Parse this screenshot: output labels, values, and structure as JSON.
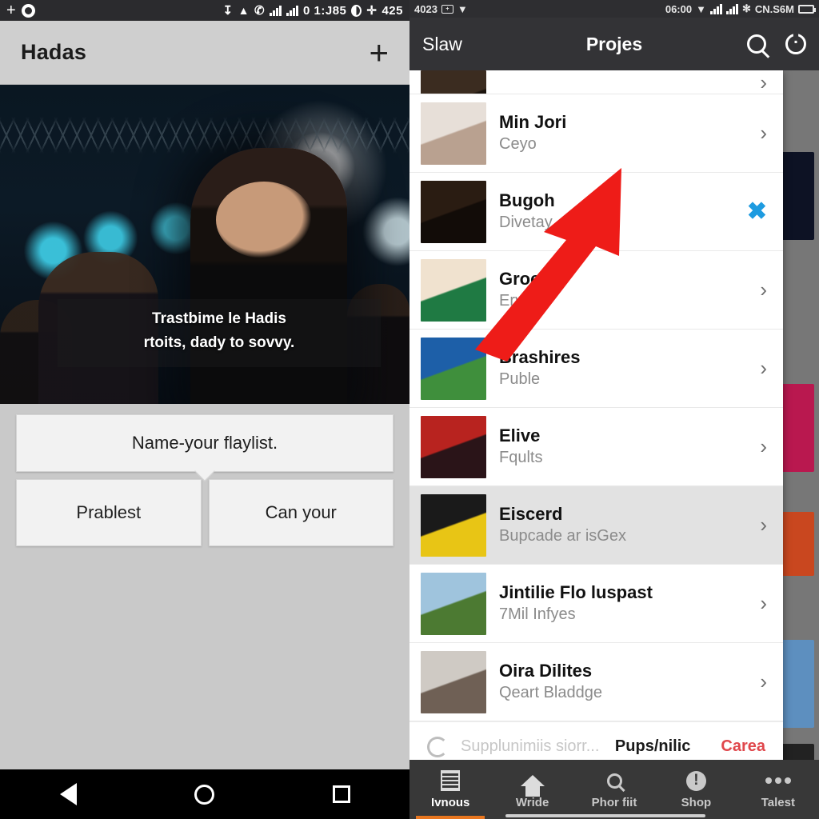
{
  "left": {
    "status_bar": {
      "add_icon": "plus-icon",
      "app_icon": "ghost-app-icon",
      "download_icon": "download-arrow-icon",
      "wifi_icon": "wifi-icon",
      "vibrate_icon": "vibrate-icon",
      "signal_icon_1": "signal-bars-icon",
      "signal_icon_2": "signal-bars-icon",
      "clock": "0 1:J85",
      "brightness_icon": "brightness-icon",
      "move_icon": "move-icon",
      "battery": "425"
    },
    "app_bar": {
      "title": "Hadas",
      "add_label": "+"
    },
    "hero": {
      "caption_line1": "Trastbime le Hadis",
      "caption_line2": "rtoits, dady to sovvy."
    },
    "dialog": {
      "message": "Name-your flaylist.",
      "button_left": "Prablest",
      "button_right": "Can your"
    },
    "nav": {
      "back": "back-icon",
      "home": "home-icon",
      "recents": "recents-icon"
    }
  },
  "right": {
    "status_bar": {
      "carrier": "4023",
      "sim_icon": "sim-card-icon",
      "wifi_icon": "wifi-icon",
      "clock": "06:00",
      "wifi2_icon": "wifi-icon",
      "signal_icon_1": "signal-bars-icon",
      "signal_icon_2": "signal-bars-icon",
      "bluetooth_icon": "bluetooth-icon",
      "network": "CN.S6M",
      "battery_icon": "battery-icon"
    },
    "app_bar": {
      "back_label": "Slaw",
      "title": "Projes",
      "search_icon": "search-icon",
      "power_icon": "power-icon"
    },
    "list": [
      {
        "title": "",
        "subtitle": "",
        "action": "chevron-right-icon",
        "cut": true,
        "selected": false,
        "thumb": {
          "a": "#3b2c20",
          "b": "#1b130d"
        }
      },
      {
        "title": "Min Jori",
        "subtitle": "Ceyo",
        "action": "chevron-right-icon",
        "cut": false,
        "selected": false,
        "thumb": {
          "a": "#e7dfd8",
          "b": "#b9a190"
        }
      },
      {
        "title": "Bugoh",
        "subtitle": "Divetay",
        "action": "close-icon",
        "cut": false,
        "selected": false,
        "thumb": {
          "a": "#2a1c12",
          "b": "#120c08"
        }
      },
      {
        "title": "Groens",
        "subtitle": "Ervoso",
        "action": "chevron-right-icon",
        "cut": false,
        "selected": false,
        "thumb": {
          "a": "#f0e2cf",
          "b": "#1f7a43"
        }
      },
      {
        "title": "Brashires",
        "subtitle": "Puble",
        "action": "chevron-right-icon",
        "cut": false,
        "selected": false,
        "thumb": {
          "a": "#1d5fa8",
          "b": "#3f8f3c"
        }
      },
      {
        "title": "Elive",
        "subtitle": "Fqults",
        "action": "chevron-right-icon",
        "cut": false,
        "selected": false,
        "thumb": {
          "a": "#b8231f",
          "b": "#2a1418"
        }
      },
      {
        "title": "Eiscerd",
        "subtitle": "Bupcade ar isGex",
        "action": "chevron-right-icon",
        "cut": false,
        "selected": true,
        "thumb": {
          "a": "#1a1a1a",
          "b": "#e8c515"
        }
      },
      {
        "title": "Jintilie Flo luspast",
        "subtitle": "7Mil Infyes",
        "action": "chevron-right-icon",
        "cut": false,
        "selected": false,
        "thumb": {
          "a": "#9fc4dd",
          "b": "#4c7a32"
        }
      },
      {
        "title": "Oira Dilites",
        "subtitle": "Qeart Bladdge",
        "action": "chevron-right-icon",
        "cut": false,
        "selected": false,
        "thumb": {
          "a": "#cfcac4",
          "b": "#6f6055"
        }
      }
    ],
    "sheet_footer": {
      "spinner_icon": "loading-spinner-icon",
      "status": "Supplunimiis siorr...",
      "primary": "Pups/nilic",
      "secondary": "Carea",
      "secondary_color": "#e0474c"
    },
    "tabbar": [
      {
        "label": "Ivnous",
        "icon": "news-icon",
        "active": true
      },
      {
        "label": "Wride",
        "icon": "home-icon",
        "active": false
      },
      {
        "label": "Phor fiit",
        "icon": "search-icon",
        "active": false
      },
      {
        "label": "Shop",
        "icon": "alert-circle-icon",
        "active": false
      },
      {
        "label": "Talest",
        "icon": "more-dots-icon",
        "active": false
      }
    ],
    "annotation": {
      "arrow_icon": "red-arrow-annotation",
      "color": "#ee1c18"
    }
  }
}
